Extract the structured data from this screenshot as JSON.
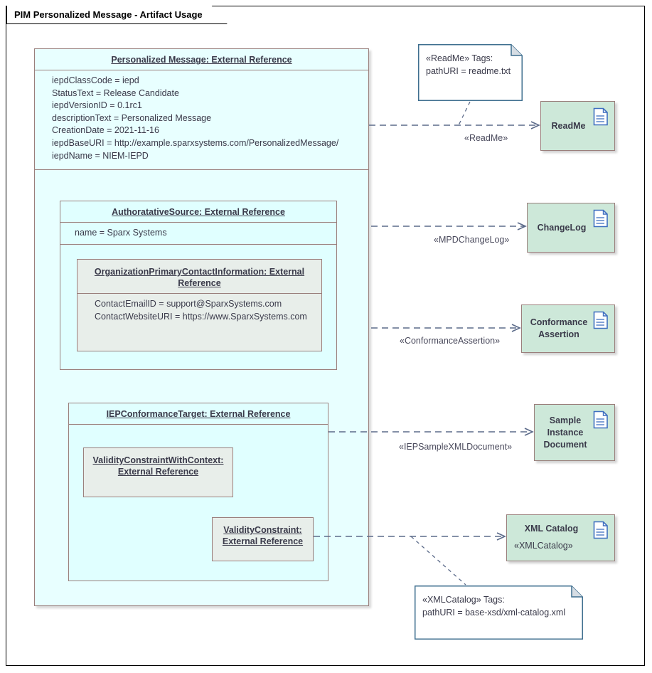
{
  "frame": {
    "title": "PIM Personalized Message - Artifact Usage"
  },
  "classes": {
    "personalized_message": {
      "title": "Personalized Message: External Reference",
      "attributes": [
        "iepdClassCode = iepd",
        "StatusText = Release Candidate",
        "iepdVersionID = 0.1rc1",
        "descriptionText = Personalized Message",
        "CreationDate = 2021-11-16",
        "iepdBaseURI = http://example.sparxsystems.com/PersonalizedMessage/",
        "iepdName = NIEM-IEPD"
      ]
    },
    "authoratative_source": {
      "title": "AuthoratativeSource: External Reference",
      "attributes": [
        "name = Sparx Systems"
      ]
    },
    "organization_contact": {
      "title_line1": "OrganizationPrimaryContactInformation: External",
      "title_line2": "Reference",
      "attributes": [
        "ContactEmailID = support@SparxSystems.com",
        "ContactWebsiteURI = https://www.SparxSystems.com"
      ]
    },
    "iep_conformance_target": {
      "title": "IEPConformanceTarget: External Reference"
    },
    "validity_constraint_with_context": {
      "title_line1": "ValidityConstraintWithContext:",
      "title_line2": "External Reference"
    },
    "validity_constraint": {
      "title_line1": "ValidityConstraint:",
      "title_line2": "External Reference"
    }
  },
  "artifacts": [
    {
      "name": "ReadMe",
      "stereotype": "",
      "icon": "artifact-document-icon"
    },
    {
      "name": "ChangeLog",
      "stereotype": "",
      "icon": "artifact-document-icon"
    },
    {
      "name_line1": "Conformance",
      "name_line2": "Assertion",
      "stereotype": "",
      "icon": "artifact-document-icon"
    },
    {
      "name_line1": "Sample",
      "name_line2": "Instance",
      "name_line3": "Document",
      "stereotype": "",
      "icon": "artifact-document-icon"
    },
    {
      "name": "XML Catalog",
      "stereotype": "«XMLCatalog»",
      "icon": "artifact-document-icon"
    }
  ],
  "artifact_labels": {
    "readme": "ReadMe",
    "changelog": "ChangeLog",
    "conformance_l1": "Conformance",
    "conformance_l2": "Assertion",
    "sample_l1": "Sample",
    "sample_l2": "Instance",
    "sample_l3": "Document",
    "xmlcatalog": "XML Catalog",
    "xmlcatalog_stereo": "«XMLCatalog»"
  },
  "connectors": [
    {
      "label": "«ReadMe»"
    },
    {
      "label": "«MPDChangeLog»"
    },
    {
      "label": "«ConformanceAssertion»"
    },
    {
      "label": "«IEPSampleXMLDocument»"
    }
  ],
  "connector_labels": {
    "readme": "«ReadMe»",
    "mpdchangelog": "«MPDChangeLog»",
    "conformanceassertion": "«ConformanceAssertion»",
    "iepsamplexmldocument": "«IEPSampleXMLDocument»"
  },
  "notes": {
    "readme_note": {
      "line1": "«ReadMe» Tags:",
      "line2": "pathURI = readme.txt"
    },
    "xmlcatalog_note": {
      "line1": "«XMLCatalog» Tags:",
      "line2": "pathURI = base-xsd/xml-catalog.xml"
    }
  },
  "colors": {
    "class_fill": "#e0ffff",
    "class_border": "#9a7f7c",
    "artifact_fill": "#cde8d9",
    "nested_ref_fill": "#e8eeea",
    "connector": "#5c6b8a",
    "note_border": "#3f6f8f",
    "icon_blue": "#3f6fc0"
  }
}
